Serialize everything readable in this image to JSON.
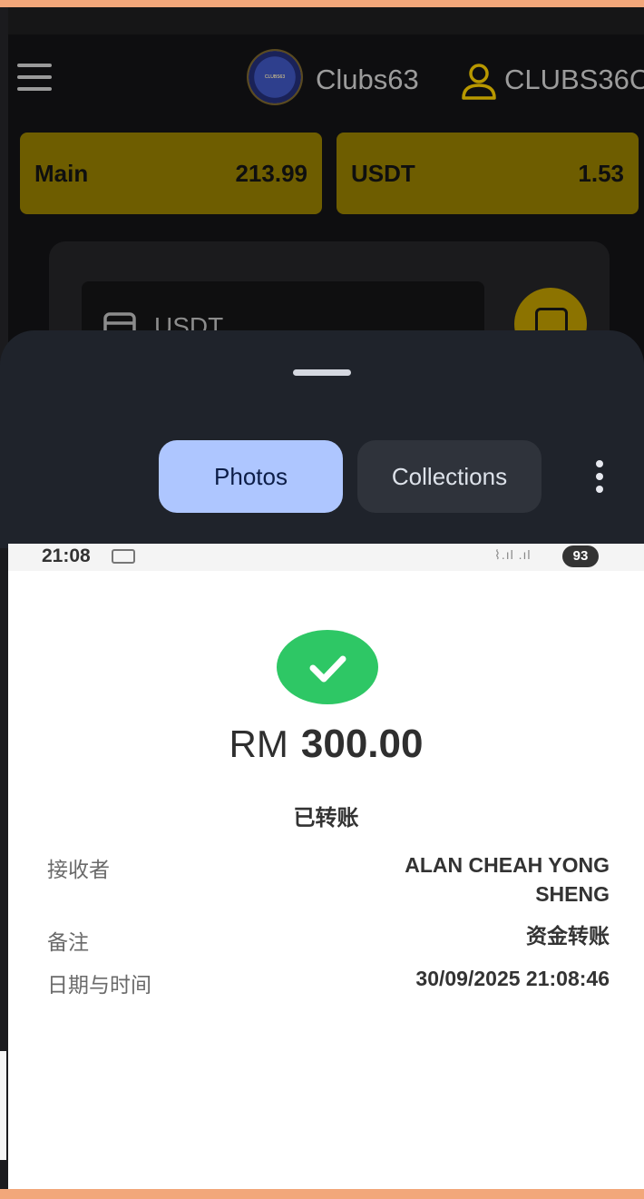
{
  "app_header": {
    "site_name": "Clubs63",
    "username": "CLUBS36C"
  },
  "wallets": [
    {
      "label": "Main",
      "amount": "213.99"
    },
    {
      "label": "USDT",
      "amount": "1.53"
    }
  ],
  "deposit_panel": {
    "selected_currency": "USDT"
  },
  "picker_sheet": {
    "tabs": [
      {
        "label": "Photos",
        "active": true
      },
      {
        "label": "Collections",
        "active": false
      }
    ]
  },
  "receipt": {
    "status_bar": {
      "time": "21:08",
      "battery": "93"
    },
    "currency": "RM",
    "amount": "300.00",
    "status": "已转账",
    "fields": [
      {
        "label": "接收者",
        "value_lines": [
          "ALAN CHEAH YONG",
          "SHENG"
        ]
      },
      {
        "label": "备注",
        "value_lines": [
          "资金转账"
        ]
      },
      {
        "label": "日期与时间",
        "value_lines": [
          "30/09/2025 21:08:46"
        ]
      }
    ]
  },
  "colors": {
    "background_orange": "#f2a77a",
    "wallet_gold": "#6e5d00",
    "active_tab": "#aec6ff",
    "success_green": "#2ec765"
  }
}
